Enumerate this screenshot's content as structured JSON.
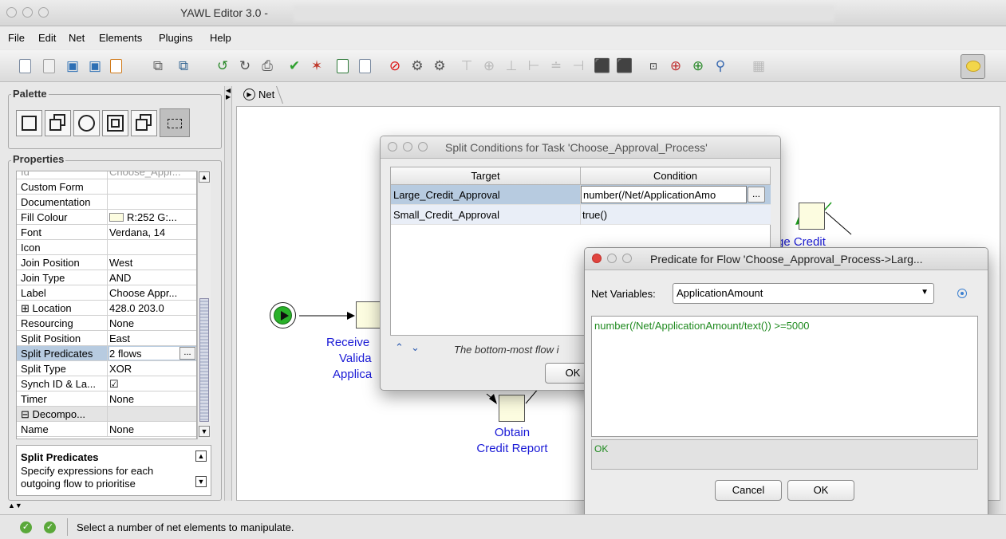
{
  "window": {
    "title": "YAWL Editor 3.0 -"
  },
  "menu": [
    {
      "label": "File"
    },
    {
      "label": "Edit"
    },
    {
      "label": "Net"
    },
    {
      "label": "Elements"
    },
    {
      "label": "Plugins"
    },
    {
      "label": "Help"
    }
  ],
  "palette": {
    "title": "Palette"
  },
  "properties": {
    "title": "Properties",
    "truncated_top": "Choose_Appr...",
    "rows": [
      {
        "key": "Custom Form",
        "value": ""
      },
      {
        "key": "Documentation",
        "value": ""
      },
      {
        "key": "Fill Colour",
        "value": "R:252 G:..."
      },
      {
        "key": "Font",
        "value": "Verdana, 14"
      },
      {
        "key": "Icon",
        "value": ""
      },
      {
        "key": "Join Position",
        "value": "West"
      },
      {
        "key": "Join Type",
        "value": "AND"
      },
      {
        "key": "Label",
        "value": "Choose Appr..."
      },
      {
        "key": "⊞ Location",
        "value": "428.0 203.0"
      },
      {
        "key": "Resourcing",
        "value": "None"
      },
      {
        "key": "Split Position",
        "value": "East"
      },
      {
        "key": "Split Predicates",
        "value": "2 flows"
      },
      {
        "key": "Split Type",
        "value": "XOR"
      },
      {
        "key": "Synch ID & La...",
        "value": "☑"
      },
      {
        "key": "Timer",
        "value": "None"
      },
      {
        "key": "⊟ Decompo...",
        "value": ""
      },
      {
        "key": "Name",
        "value": "None"
      }
    ],
    "help_title": "Split Predicates",
    "help_text": "Specify expressions for each outgoing flow to prioritise"
  },
  "canvas": {
    "tab_label": "Net",
    "tasks": {
      "receive_label_line1": "Receive",
      "receive_label_line2": "Valida",
      "receive_label_line3": "Applica",
      "obtain_line1": "Obtain",
      "obtain_line2": "Credit Report",
      "large_label": "rge Credit"
    }
  },
  "split_dialog": {
    "title": "Split Conditions for Task 'Choose_Approval_Process'",
    "col_target": "Target",
    "col_condition": "Condition",
    "rows": [
      {
        "target": "Large_Credit_Approval",
        "condition": "number(/Net/ApplicationAmo"
      },
      {
        "target": "Small_Credit_Approval",
        "condition": "true()"
      }
    ],
    "dots_label": "...",
    "note": "The bottom-most flow i",
    "ok_label": "OK"
  },
  "predicate_dialog": {
    "title": "Predicate for Flow 'Choose_Approval_Process->Larg...",
    "net_variables_label": "Net Variables:",
    "selected_variable": "ApplicationAmount",
    "expression": "number(/Net/ApplicationAmount/text()) >=5000",
    "status": "OK",
    "cancel_label": "Cancel",
    "ok_label": "OK"
  },
  "statusbar": {
    "message": "Select a number of net elements to manipulate."
  },
  "colors": {
    "task_fill": "#fcfce0",
    "task_label": "#1a1ad6",
    "predicate_green": "#1f8a1f",
    "selection": "#b7cbe0"
  }
}
